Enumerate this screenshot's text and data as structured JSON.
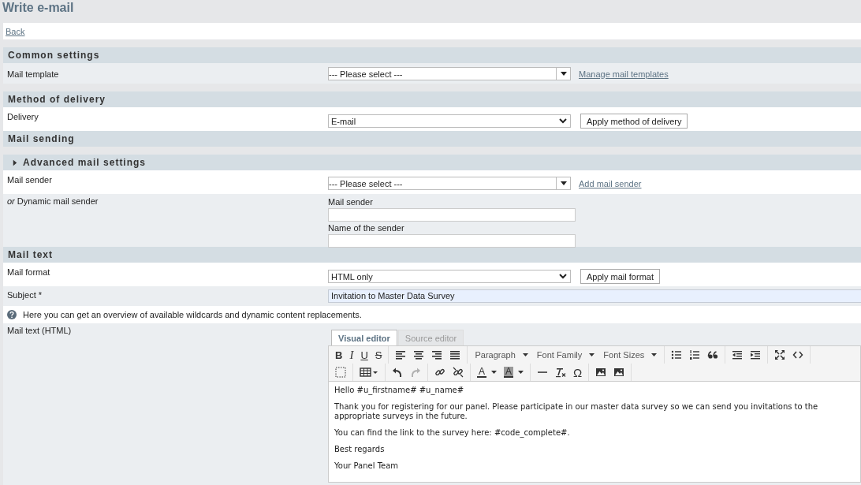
{
  "title": "Write e-mail",
  "back_link": "Back",
  "sections": [
    {
      "title": "Common settings",
      "kind": "header",
      "rows": [
        {
          "kind": "select",
          "label": "Mail template",
          "shaded": true,
          "value": "--- Please select ---",
          "combo": true,
          "link": "Manage mail templates"
        }
      ]
    },
    {
      "title": "Method of delivery",
      "kind": "header",
      "rows": [
        {
          "kind": "select",
          "label": "Delivery",
          "shaded": false,
          "value": "E-mail",
          "combo": false,
          "button": "Apply method of delivery"
        }
      ]
    },
    {
      "title": "Mail sending",
      "kind": "header"
    },
    {
      "title": "Advanced mail settings",
      "kind": "subheader",
      "expanded": false,
      "rows": [
        {
          "kind": "select",
          "label": "Mail sender",
          "shaded": false,
          "value": "--- Please select ---",
          "combo": true,
          "link": "Add mail sender"
        },
        {
          "kind": "fields",
          "label_prefix": "or",
          "label": "Dynamic mail sender",
          "shaded": true,
          "fields": [
            "Mail sender",
            "Name of the sender"
          ]
        }
      ]
    },
    {
      "title": "Mail text",
      "kind": "header",
      "rows": [
        {
          "kind": "select",
          "label": "Mail format",
          "shaded": false,
          "value": "HTML only",
          "combo": false,
          "button": "Apply mail format"
        },
        {
          "kind": "input",
          "label": "Subject *",
          "shaded": true,
          "value": "Invitation to Master Data Survey"
        },
        {
          "kind": "info",
          "shaded": false,
          "text": "Here you can get an overview of available wildcards and dynamic content replacements."
        },
        {
          "kind": "editor",
          "label": "Mail text (HTML)",
          "shaded": true
        }
      ]
    }
  ],
  "editor": {
    "tabs": [
      {
        "label": "Visual editor",
        "selected": true
      },
      {
        "label": "Source editor",
        "selected": false
      }
    ],
    "toolbar_labels": [
      "B",
      "I",
      "U",
      "S",
      "Paragraph",
      "Font Family",
      "Font Sizes",
      "A",
      "A",
      "Ω"
    ],
    "paragraphs": [
      "Hello #u_firstname# #u_name#",
      "Thank you for registering for our panel. Please participate in our master data survey so we can send you invitations to the appropriate surveys in the future.",
      "You can find the link to the survey here: #code_complete#.",
      "Best regards",
      "Your Panel Team"
    ]
  }
}
